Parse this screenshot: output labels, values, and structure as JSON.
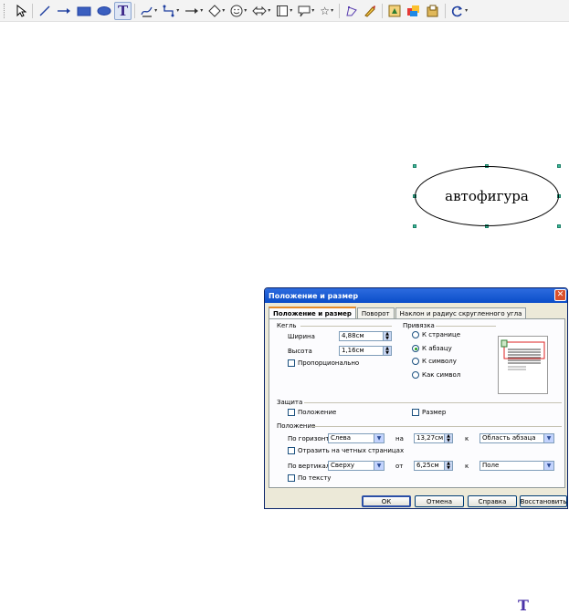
{
  "shape": {
    "label": "автофигура"
  },
  "dialog": {
    "title": "Положение и размер",
    "tabs": [
      "Положение и размер",
      "Поворот",
      "Наклон и радиус скругленного угла"
    ],
    "size_group": "Кегль",
    "width_label": "Ширина",
    "width_value": "4,88см",
    "height_label": "Высота",
    "height_value": "1,16см",
    "proportional_label": "Пропорционально",
    "anchor_group": "Привязка",
    "anchor_options": [
      "К странице",
      "К абзацу",
      "К символу",
      "Как символ"
    ],
    "anchor_selected": "К абзацу",
    "protect_group": "Защита",
    "protect_position": "Положение",
    "protect_size": "Размер",
    "position_group": "Положение",
    "horiz_label": "По горизонт.",
    "horiz_value": "Слева",
    "horiz_by_label": "на",
    "horiz_offset": "13,27см",
    "horiz_to_label": "к",
    "horiz_to_value": "Область абзаца",
    "mirror_label": "Отразить на четных страницах",
    "vert_label": "По вертикали",
    "vert_value": "Сверху",
    "vert_by_label": "от",
    "vert_offset": "6,25см",
    "vert_to_label": "к",
    "vert_to_value": "Поле",
    "follow_text_label": "По тексту",
    "ok_label": "ОК",
    "cancel_label": "Отмена",
    "help_label": "Справка",
    "reset_label": "Восстановить"
  },
  "colors": {
    "title_bar": "#0b4dc9",
    "handle": "#3db89a",
    "dialog_bg": "#ece9d8"
  },
  "icons": [
    "select-arrow-icon",
    "line-icon",
    "arrow-line-icon",
    "rectangle-icon",
    "ellipse-icon",
    "text-icon",
    "freeform-icon",
    "connector-icon",
    "lines-arrows-icon",
    "basic-shapes-icon",
    "symbol-shapes-icon",
    "block-arrows-icon",
    "flowchart-icon",
    "callout-icon",
    "stars-icon",
    "points-icon",
    "fontwork-icon",
    "from-file-icon",
    "gallery-icon",
    "extrusion-icon",
    "rotate-icon"
  ]
}
